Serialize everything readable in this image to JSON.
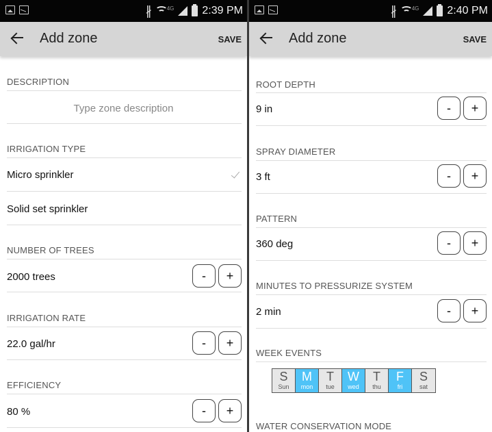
{
  "left": {
    "status_bar": {
      "time": "2:39 PM",
      "network": "4G"
    },
    "toolbar": {
      "title": "Add zone",
      "save_label": "SAVE"
    },
    "description": {
      "label": "DESCRIPTION",
      "placeholder": "Type zone description"
    },
    "irrigation_type": {
      "label": "IRRIGATION TYPE",
      "options": [
        {
          "label": "Micro sprinkler",
          "selected": true
        },
        {
          "label": "Solid set sprinkler",
          "selected": false
        }
      ]
    },
    "number_of_trees": {
      "label": "NUMBER OF TREES",
      "value": "2000 trees"
    },
    "irrigation_rate": {
      "label": "IRRIGATION RATE",
      "value": "22.0 gal/hr"
    },
    "efficiency": {
      "label": "EFFICIENCY",
      "value": "80 %"
    }
  },
  "right": {
    "status_bar": {
      "time": "2:40 PM",
      "network": "4G"
    },
    "toolbar": {
      "title": "Add zone",
      "save_label": "SAVE"
    },
    "root_depth": {
      "label": "ROOT DEPTH",
      "value": "9 in"
    },
    "spray_diameter": {
      "label": "SPRAY DIAMETER",
      "value": "3 ft"
    },
    "pattern": {
      "label": "PATTERN",
      "value": "360 deg"
    },
    "minutes_to_pressurize": {
      "label": "MINUTES TO PRESSURIZE SYSTEM",
      "value": "2 min"
    },
    "week_events": {
      "label": "WEEK EVENTS",
      "days": [
        {
          "letter": "S",
          "short": "Sun",
          "selected": false
        },
        {
          "letter": "M",
          "short": "mon",
          "selected": true
        },
        {
          "letter": "T",
          "short": "tue",
          "selected": false
        },
        {
          "letter": "W",
          "short": "wed",
          "selected": true
        },
        {
          "letter": "T",
          "short": "thu",
          "selected": false
        },
        {
          "letter": "F",
          "short": "fri",
          "selected": true
        },
        {
          "letter": "S",
          "short": "sat",
          "selected": false
        }
      ]
    },
    "water_conservation": {
      "label": "WATER CONSERVATION MODE"
    }
  },
  "stepper": {
    "minus_label": "-",
    "plus_label": "+"
  },
  "colors": {
    "toolbar_bg": "#d6d6d6",
    "status_bg": "#050505",
    "day_selected": "#4fc3f7",
    "day_unselected": "#e7e7e7"
  },
  "icons": {
    "back": "arrow-left-icon",
    "check": "check-icon",
    "bluetooth": "bluetooth-icon",
    "wifi": "wifi-icon",
    "signal": "signal-icon",
    "battery": "battery-icon"
  }
}
